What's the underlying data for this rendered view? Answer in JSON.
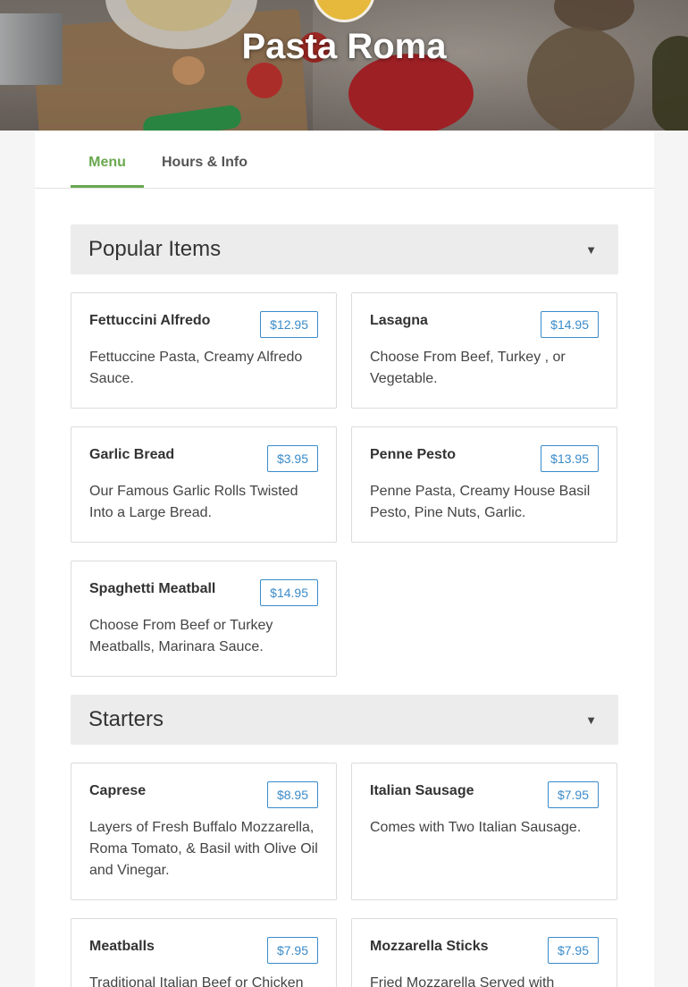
{
  "restaurant": {
    "name": "Pasta Roma"
  },
  "tabs": [
    {
      "label": "Menu",
      "active": true
    },
    {
      "label": "Hours & Info",
      "active": false
    }
  ],
  "sections": [
    {
      "title": "Popular Items",
      "items": [
        {
          "name": "Fettuccini Alfredo",
          "price": "$12.95",
          "description": "Fettuccine Pasta, Creamy Alfredo Sauce."
        },
        {
          "name": "Lasagna",
          "price": "$14.95",
          "description": "Choose From Beef, Turkey , or Vegetable."
        },
        {
          "name": "Garlic Bread",
          "price": "$3.95",
          "description": "Our Famous Garlic Rolls Twisted Into a Large Bread."
        },
        {
          "name": "Penne Pesto",
          "price": "$13.95",
          "description": "Penne Pasta, Creamy House Basil Pesto, Pine Nuts, Garlic."
        },
        {
          "name": "Spaghetti Meatball",
          "price": "$14.95",
          "description": "Choose From Beef or Turkey Meatballs, Marinara Sauce."
        }
      ]
    },
    {
      "title": "Starters",
      "items": [
        {
          "name": "Caprese",
          "price": "$8.95",
          "description": "Layers of Fresh Buffalo Mozzarella, Roma Tomato, & Basil with Olive Oil and Vinegar."
        },
        {
          "name": "Italian Sausage",
          "price": "$7.95",
          "description": "Comes with Two Italian Sausage."
        },
        {
          "name": "Meatballs",
          "price": "$7.95",
          "description": "Traditional Italian Beef or Chicken"
        },
        {
          "name": "Mozzarella Sticks",
          "price": "$7.95",
          "description": "Fried Mozzarella Served with"
        }
      ]
    }
  ],
  "icons": {
    "section_toggle": "caret-down-icon",
    "caret_glyph": "▼"
  },
  "colors": {
    "accent": "#6aa84f",
    "price": "#3a8bc9",
    "section_bg": "#ececec"
  }
}
